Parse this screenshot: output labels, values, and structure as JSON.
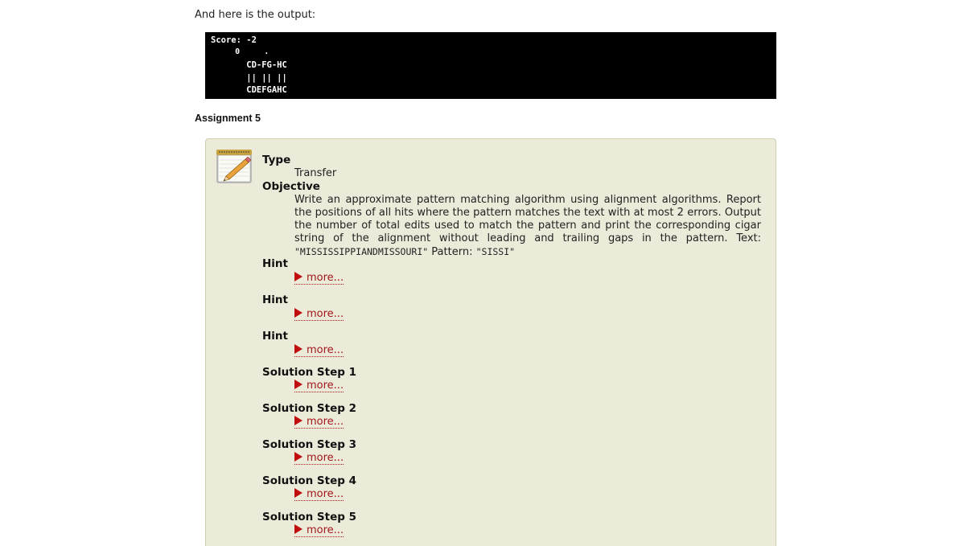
{
  "intro_text": "And here is the output:",
  "console": {
    "lines": [
      "Score: -2",
      "     0     .",
      "       CD-FG-HC",
      "       || || ||",
      "       CDEFGAHC"
    ]
  },
  "assignment_title": "Assignment 5",
  "panel": {
    "icon": "notepad-pencil-icon",
    "type_label": "Type",
    "type_value": "Transfer",
    "objective_label": "Objective",
    "objective_text_before": "Write an approximate pattern matching algorithm using alignment algorithms. Report the positions of all hits where the pattern matches the text with at most 2 errors. Output the number of total edits used to match the pattern and print the corresponding cigar string of the alignment without leading and trailing gaps in the pattern. Text: ",
    "objective_text_code1": "\"MISSISSIPPIANDMISSOURI\"",
    "objective_text_mid": " Pattern: ",
    "objective_text_code2": "\"SISSI\"",
    "items": [
      {
        "label": "Hint",
        "link": "more..."
      },
      {
        "label": "Hint",
        "link": "more..."
      },
      {
        "label": "Hint",
        "link": "more..."
      },
      {
        "label": "Solution Step 1",
        "link": "more..."
      },
      {
        "label": "Solution Step 2",
        "link": "more..."
      },
      {
        "label": "Solution Step 3",
        "link": "more..."
      },
      {
        "label": "Solution Step 4",
        "link": "more..."
      },
      {
        "label": "Solution Step 5",
        "link": "more..."
      }
    ]
  },
  "colors": {
    "panel_bg": "#ecebda",
    "link": "#a3171b",
    "console_bg": "#000000"
  }
}
